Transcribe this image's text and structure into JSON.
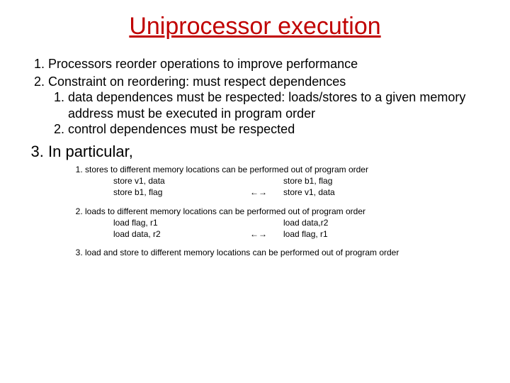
{
  "title": "Uniprocessor execution",
  "p1": "Processors reorder operations to improve performance",
  "p2": "Constraint on reordering: must respect dependences",
  "p2_1": "data dependences must be respected: loads/stores to a given memory address must be executed in program order",
  "p2_2": "control dependences must be respected",
  "p3": "In particular,",
  "s1": "stores to different memory locations can be performed out of program order",
  "s1_l1a": "store v1, data",
  "s1_l1b": "store b1, flag",
  "s1_l2a": "store b1, flag",
  "s1_l2b": "store v1, data",
  "arrow": "←→",
  "s2": "loads to different memory locations can be performed out of program order",
  "s2_l1a": "load flag, r1",
  "s2_l1b": "load data,r2",
  "s2_l2a": "load data, r2",
  "s2_l2b": "load flag, r1",
  "s3": "load and store to different memory locations can be performed out of program order"
}
